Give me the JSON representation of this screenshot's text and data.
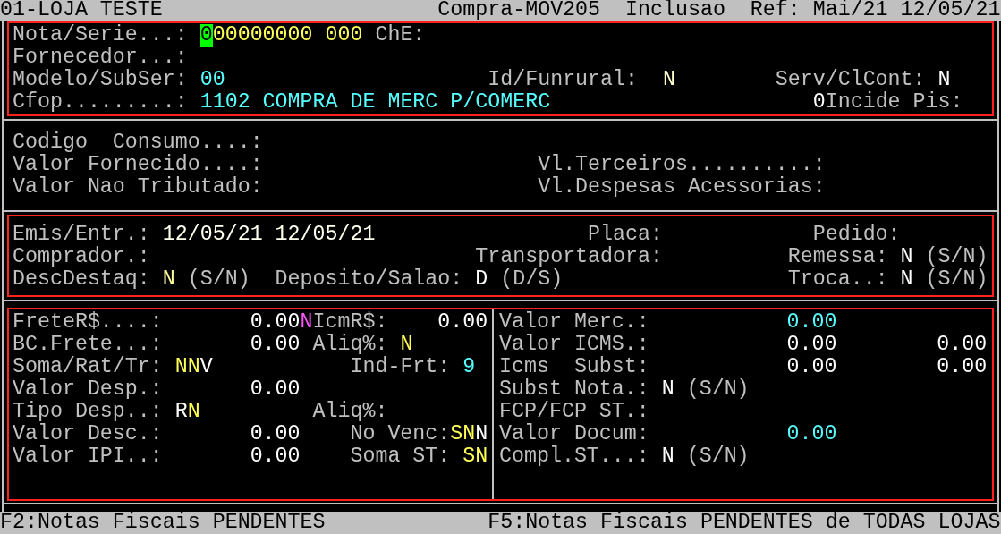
{
  "header": [
    {
      "text": "01-LOJA TESTE"
    },
    {
      "text": "Compra-MOV205"
    },
    {
      "text": "Inclusao"
    },
    {
      "text": "Ref:"
    },
    {
      "text": "Mai/21"
    },
    {
      "text": "12/05/21"
    }
  ],
  "sections": [
    {
      "highlighted": true,
      "rows": [
        {
          "segments": [
            {
              "kind": "label",
              "text": "Nota/Serie...:"
            },
            {
              "kind": "cursor",
              "text": "0",
              "color": "#00ff00"
            },
            {
              "kind": "value",
              "text": "00000000",
              "color": "#ffff55"
            },
            {
              "kind": "value",
              "text": "000",
              "color": "#ffff55"
            },
            {
              "kind": "label",
              "text": "ChE:"
            }
          ]
        },
        {
          "segments": [
            {
              "kind": "label",
              "text": "Fornecedor...:"
            }
          ]
        },
        {
          "segments": [
            {
              "kind": "label",
              "text": "Modelo/SubSer:"
            },
            {
              "kind": "value",
              "text": "00",
              "color": "#55ffff"
            },
            {
              "kind": "label",
              "text": "Id/Funrural:"
            },
            {
              "kind": "value",
              "text": "N",
              "color": "#ffffcc"
            },
            {
              "kind": "label",
              "text": "Serv/ClCont:"
            },
            {
              "kind": "value",
              "text": "N",
              "color": "#ffffff"
            }
          ]
        },
        {
          "segments": [
            {
              "kind": "label",
              "text": "Cfop.........:"
            },
            {
              "kind": "value",
              "text": "1102 COMPRA DE MERC P/COMERC",
              "color": "#55ffff"
            },
            {
              "kind": "value",
              "text": "0",
              "color": "#ffffff"
            },
            {
              "kind": "label",
              "text": "Incide Pis:"
            }
          ]
        }
      ]
    },
    {
      "highlighted": false,
      "rows": [
        {
          "segments": [
            {
              "kind": "label",
              "text": "Codigo  Consumo....:"
            }
          ]
        },
        {
          "segments": [
            {
              "kind": "label",
              "text": "Valor Fornecido....:"
            },
            {
              "kind": "label",
              "text": "Vl.Terceiros..........:"
            }
          ]
        },
        {
          "segments": [
            {
              "kind": "label",
              "text": "Valor Nao Tributado:"
            },
            {
              "kind": "label",
              "text": "Vl.Despesas Acessorias:"
            }
          ]
        }
      ]
    },
    {
      "highlighted": true,
      "rows": [
        {
          "segments": [
            {
              "kind": "label",
              "text": "Emis/Entr.:"
            },
            {
              "kind": "value",
              "text": "12/05/21",
              "color": "#ffffee"
            },
            {
              "kind": "value",
              "text": "12/05/21",
              "color": "#ffffee"
            },
            {
              "kind": "label",
              "text": "Placa:"
            },
            {
              "kind": "label",
              "text": "Pedido:"
            }
          ]
        },
        {
          "segments": [
            {
              "kind": "label",
              "text": "Comprador.:"
            },
            {
              "kind": "label",
              "text": "Transportadora:"
            },
            {
              "kind": "label",
              "text": "Remessa:"
            },
            {
              "kind": "value",
              "text": "N",
              "color": "#ffffff"
            },
            {
              "kind": "label",
              "text": "(S/N)"
            }
          ]
        },
        {
          "segments": [
            {
              "kind": "label",
              "text": "DescDestaq:"
            },
            {
              "kind": "value",
              "text": "N",
              "color": "#ffff99"
            },
            {
              "kind": "label",
              "text": "(S/N)"
            },
            {
              "kind": "label",
              "text": "Deposito/Salao:"
            },
            {
              "kind": "value",
              "text": "D",
              "color": "#ffffff"
            },
            {
              "kind": "label",
              "text": "(D/S)"
            },
            {
              "kind": "label",
              "text": "Troca..:"
            },
            {
              "kind": "value",
              "text": "N",
              "color": "#ffffff"
            },
            {
              "kind": "label",
              "text": "(S/N)"
            }
          ]
        }
      ]
    }
  ],
  "totals": {
    "highlighted": true,
    "left_rows": [
      {
        "segments": [
          {
            "kind": "label",
            "text": "FreteR$....:"
          },
          {
            "kind": "value",
            "text": "0.00",
            "color": "#ffffff"
          },
          {
            "kind": "value",
            "text": "N",
            "color": "#ff55ff"
          },
          {
            "kind": "label",
            "text": "IcmR$:"
          },
          {
            "kind": "value",
            "text": "0.00",
            "color": "#ffffff"
          }
        ]
      },
      {
        "segments": [
          {
            "kind": "label",
            "text": "BC.Frete...:"
          },
          {
            "kind": "value",
            "text": "0.00",
            "color": "#ffffff"
          },
          {
            "kind": "label",
            "text": "Aliq%:"
          },
          {
            "kind": "value",
            "text": "N",
            "color": "#ffff55"
          }
        ]
      },
      {
        "segments": [
          {
            "kind": "label",
            "text": "Soma/Rat/Tr:"
          },
          {
            "kind": "value",
            "text": "NN",
            "color": "#ffff55"
          },
          {
            "kind": "value",
            "text": "V",
            "color": "#ffffff"
          },
          {
            "kind": "label",
            "text": "Ind-Frt:"
          },
          {
            "kind": "value",
            "text": "9",
            "color": "#55ffff"
          }
        ]
      },
      {
        "segments": [
          {
            "kind": "label",
            "text": "Valor Desp.:"
          },
          {
            "kind": "value",
            "text": "0.00",
            "color": "#ffffff"
          }
        ]
      },
      {
        "segments": [
          {
            "kind": "label",
            "text": "Tipo Desp..:"
          },
          {
            "kind": "value",
            "text": "R",
            "color": "#ffffff"
          },
          {
            "kind": "value",
            "text": "N",
            "color": "#ffff55"
          },
          {
            "kind": "label",
            "text": "Aliq%:"
          }
        ]
      },
      {
        "segments": [
          {
            "kind": "label",
            "text": "Valor Desc.:"
          },
          {
            "kind": "value",
            "text": "0.00",
            "color": "#ffffff"
          },
          {
            "kind": "label",
            "text": "No Venc:"
          },
          {
            "kind": "value",
            "text": "SN",
            "color": "#ffff55"
          },
          {
            "kind": "value",
            "text": "N",
            "color": "#ffffff"
          }
        ]
      },
      {
        "segments": [
          {
            "kind": "label",
            "text": "Valor IPI..:"
          },
          {
            "kind": "value",
            "text": "0.00",
            "color": "#ffffff"
          },
          {
            "kind": "label",
            "text": "Soma ST:"
          },
          {
            "kind": "value",
            "text": "SN",
            "color": "#ffff55"
          }
        ]
      }
    ],
    "right_rows": [
      {
        "segments": [
          {
            "kind": "label",
            "text": "Valor Merc.:"
          },
          {
            "kind": "value",
            "text": "0.00",
            "color": "#55ffff"
          }
        ]
      },
      {
        "segments": [
          {
            "kind": "label",
            "text": "Valor ICMS.:"
          },
          {
            "kind": "value",
            "text": "0.00",
            "color": "#ffffff"
          },
          {
            "kind": "value",
            "text": "0.00",
            "color": "#ffffff"
          }
        ]
      },
      {
        "segments": [
          {
            "kind": "label",
            "text": "Icms  Subst:"
          },
          {
            "kind": "value",
            "text": "0.00",
            "color": "#ffffff"
          },
          {
            "kind": "value",
            "text": "0.00",
            "color": "#ffffff"
          }
        ]
      },
      {
        "segments": [
          {
            "kind": "label",
            "text": "Subst Nota.:"
          },
          {
            "kind": "value",
            "text": "N",
            "color": "#ffffff"
          },
          {
            "kind": "label",
            "text": "(S/N)"
          }
        ]
      },
      {
        "segments": [
          {
            "kind": "label",
            "text": "FCP/FCP ST.:"
          }
        ]
      },
      {
        "segments": [
          {
            "kind": "label",
            "text": "Valor Docum:"
          },
          {
            "kind": "value",
            "text": "0.00",
            "color": "#55ffff"
          }
        ]
      },
      {
        "segments": [
          {
            "kind": "label",
            "text": "Compl.ST...:"
          },
          {
            "kind": "value",
            "text": "N",
            "color": "#ffffff"
          },
          {
            "kind": "label",
            "text": "(S/N)"
          }
        ]
      }
    ]
  },
  "footer": [
    {
      "text": "F2:Notas Fiscais PENDENTES"
    },
    {
      "text": "F5:Notas Fiscais PENDENTES de TODAS LOJAS"
    }
  ]
}
